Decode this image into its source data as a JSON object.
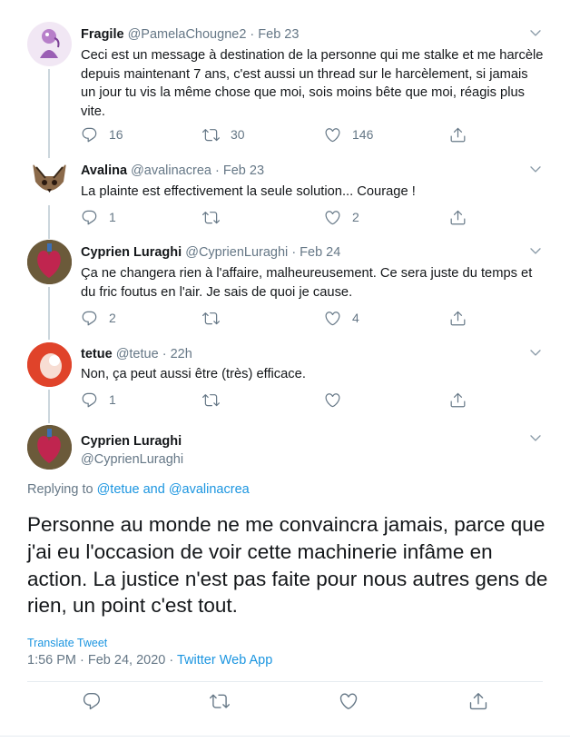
{
  "replies": [
    {
      "name": "Fragile",
      "handle": "@PamelaChougne2",
      "date": "Feb 23",
      "text": "Ceci est un message à destination de la personne qui me stalke et me harcèle depuis maintenant 7 ans, c'est aussi un thread sur le harcèlement, si jamais un jour tu vis la même chose que moi, sois moins bête que moi, réagis plus vite.",
      "reply_count": "16",
      "retweet_count": "30",
      "like_count": "146"
    },
    {
      "name": "Avalina",
      "handle": "@avalinacrea",
      "date": "Feb 23",
      "text": "La plainte est effectivement la seule solution... Courage !",
      "reply_count": "1",
      "retweet_count": "",
      "like_count": "2"
    },
    {
      "name": "Cyprien Luraghi",
      "handle": "@CyprienLuraghi",
      "date": "Feb 24",
      "text": "Ça ne changera rien à l'affaire, malheureusement. Ce sera juste du temps et du fric foutus en l'air. Je sais de quoi je cause.",
      "reply_count": "2",
      "retweet_count": "",
      "like_count": "4"
    },
    {
      "name": "tetue",
      "handle": "@tetue",
      "date": "22h",
      "text": "Non, ça peut aussi être (très) efficace.",
      "reply_count": "1",
      "retweet_count": "",
      "like_count": ""
    }
  ],
  "main_tweet": {
    "name": "Cyprien Luraghi",
    "handle": "@CyprienLuraghi",
    "replying_prefix": "Replying to",
    "replying_user1": "@tetue",
    "replying_and": "and",
    "replying_user2": "@avalinacrea",
    "text": "Personne au monde ne me convaincra jamais, parce que j'ai eu l'occasion de voir cette machinerie infâme en action. La justice n'est pas faite pour nous autres gens de rien, un point c'est tout.",
    "translate_label": "Translate Tweet",
    "timestamp": "1:56 PM · Feb 24, 2020 ·",
    "source_app": "Twitter Web App"
  },
  "colors": {
    "accent": "#1b95e0",
    "secondary_text": "#657786",
    "thread_line": "#ccd6dd",
    "separator": "#e6ecf0"
  },
  "icons": {
    "reply": "comment-icon",
    "retweet": "retweet-icon",
    "like": "heart-icon",
    "share": "share-icon",
    "more": "chevron-down-icon"
  }
}
